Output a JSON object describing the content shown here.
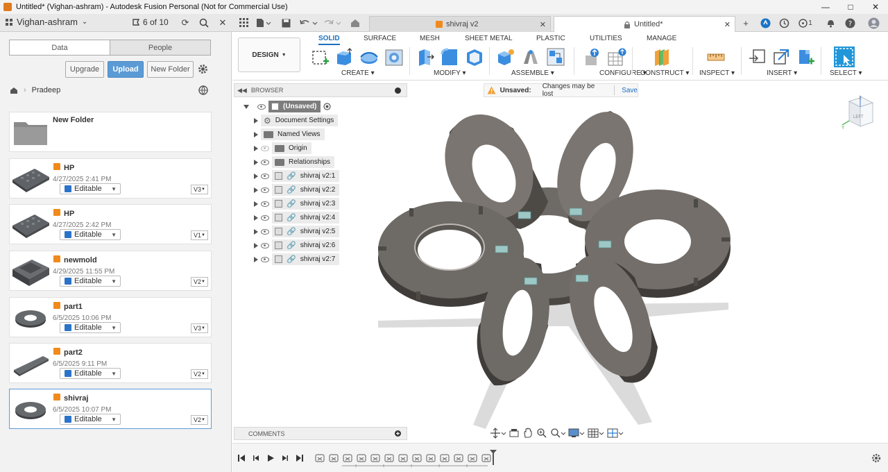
{
  "window": {
    "title": "Untitled* (Vighan-ashram) - Autodesk Fusion Personal (Not for Commercial Use)"
  },
  "appbar": {
    "team": "Vighan-ashram",
    "counter": "6 of 10",
    "tabs": [
      {
        "label": "shivraj v2",
        "active": false
      },
      {
        "label": "Untitled*",
        "active": true
      }
    ],
    "notification_count": "1"
  },
  "data_panel": {
    "segments": [
      "Data",
      "People"
    ],
    "buttons": {
      "upgrade": "Upgrade",
      "upload": "Upload",
      "new_folder": "New Folder"
    },
    "breadcrumb": "Pradeep",
    "folder": {
      "name": "New Folder"
    },
    "files": [
      {
        "name": "HP",
        "date": "4/27/2025 2:41 PM",
        "status": "Editable",
        "version": "V3"
      },
      {
        "name": "HP",
        "date": "4/27/2025 2:42 PM",
        "status": "Editable",
        "version": "V1"
      },
      {
        "name": "newmold",
        "date": "4/29/2025 11:55 PM",
        "status": "Editable",
        "version": "V2"
      },
      {
        "name": "part1",
        "date": "6/5/2025 10:06 PM",
        "status": "Editable",
        "version": "V3"
      },
      {
        "name": "part2",
        "date": "6/5/2025 9:11 PM",
        "status": "Editable",
        "version": "V2"
      },
      {
        "name": "shivraj",
        "date": "6/5/2025 10:07 PM",
        "status": "Editable",
        "version": "V2"
      }
    ]
  },
  "toolbar": {
    "workspace": "DESIGN",
    "tabs": [
      "SOLID",
      "SURFACE",
      "MESH",
      "SHEET METAL",
      "PLASTIC",
      "UTILITIES",
      "MANAGE"
    ],
    "active_tab": "SOLID",
    "groups": [
      "CREATE",
      "MODIFY",
      "ASSEMBLE",
      "CONFIGURE",
      "CONSTRUCT",
      "INSPECT",
      "INSERT",
      "SELECT"
    ]
  },
  "browser": {
    "header": "BROWSER",
    "root": "(Unsaved)",
    "items": [
      "Document Settings",
      "Named Views",
      "Origin",
      "Relationships",
      "shivraj v2:1",
      "shivraj v2:2",
      "shivraj v2:3",
      "shivraj v2:4",
      "shivraj v2:5",
      "shivraj v2:6",
      "shivraj v2:7"
    ]
  },
  "banner": {
    "label": "Unsaved:",
    "message": "Changes may be lost",
    "action": "Save"
  },
  "viewcube": {
    "face": "LEFT"
  },
  "comments": {
    "label": "COMMENTS"
  },
  "colors": {
    "accent": "#1a6fbf",
    "upload": "#5b9bd5",
    "part": "#6b6560",
    "select": "#2196d9"
  }
}
